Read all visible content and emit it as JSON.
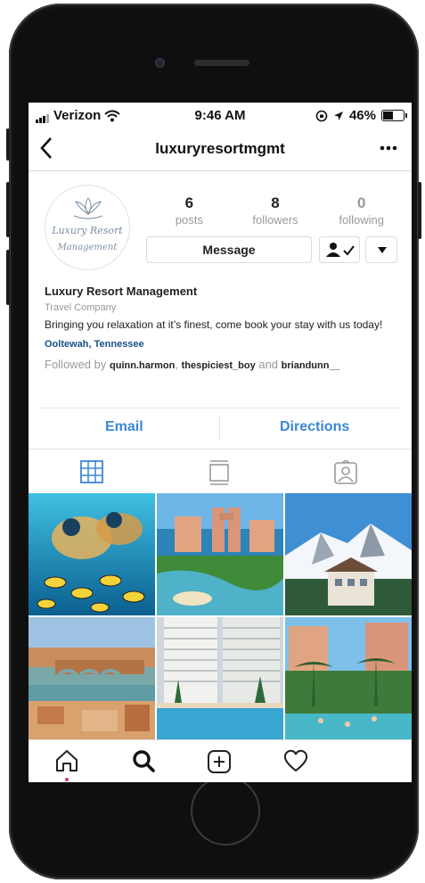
{
  "status_bar": {
    "carrier": "Verizon",
    "time": "9:46 AM",
    "battery": "46%",
    "battery_level": 0.46
  },
  "nav": {
    "back_icon": "chevron-left-icon",
    "username": "luxuryresortmgmt",
    "more_icon": "ellipsis-icon"
  },
  "profile": {
    "avatar_logo": {
      "line1": "Luxury Resort",
      "line2": "Management"
    },
    "stats": [
      {
        "value": "6",
        "label": "posts"
      },
      {
        "value": "8",
        "label": "followers"
      },
      {
        "value": "0",
        "label": "following"
      }
    ],
    "message_label": "Message",
    "name": "Luxury Resort Management",
    "category": "Travel Company",
    "bio": "Bringing you relaxation at it’s finest, come book your stay with us today!",
    "location": "Ooltewah, Tennessee",
    "followed_by": {
      "prefix": "Followed by",
      "user1": "quinn.harmon",
      "sep": ",",
      "user2": "thespiciest_boy",
      "and": "and",
      "user3": "briandunn__"
    }
  },
  "contact": {
    "email": "Email",
    "directions": "Directions"
  },
  "tabs": [
    "grid-icon",
    "feed-icon",
    "tagged-icon"
  ],
  "posts": [
    "snorkel-reef",
    "atlantis-resort",
    "mountain-ski-lodge",
    "florence-bridge",
    "highrise-pool",
    "resort-pool-palms"
  ],
  "bottom_nav": [
    "home-icon",
    "search-icon",
    "add-post-icon",
    "heart-icon"
  ],
  "colors": {
    "link": "#3b87d6",
    "location": "#1a4f8a",
    "active_tab": "#3b87d6",
    "muted": "#999999"
  }
}
